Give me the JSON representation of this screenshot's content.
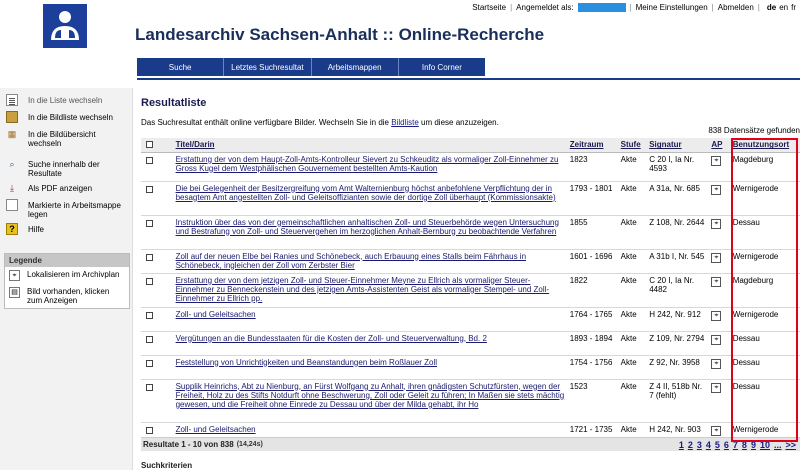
{
  "topbar": {
    "home": "Startseite",
    "logged_in_as": "Angemeldet als:",
    "settings": "Meine Einstellungen",
    "logout": "Abmelden",
    "lang_de": "de",
    "lang_en": "en",
    "lang_fr": "fr"
  },
  "header": {
    "title": "Landesarchiv Sachsen-Anhalt :: Online-Recherche"
  },
  "mainnav": [
    "Suche",
    "Letztes Suchresultat",
    "Arbeitsmappen",
    "Info Corner"
  ],
  "sidebar": {
    "items": [
      {
        "label": "In die Liste wechseln",
        "icon": "list-icon"
      },
      {
        "label": "In die Bildliste wechseln",
        "icon": "image-list-icon"
      },
      {
        "label": "In die Bildübersicht wechseln",
        "icon": "image-grid-icon"
      },
      {
        "label": "Suche innerhalb der Resultate",
        "icon": "search-icon"
      },
      {
        "label": "Als PDF anzeigen",
        "icon": "pdf-icon"
      },
      {
        "label": "Markierte in Arbeitsmappe legen",
        "icon": "folder-icon"
      },
      {
        "label": "Hilfe",
        "icon": "help-icon"
      }
    ],
    "legend": {
      "title": "Legende",
      "items": [
        {
          "label": "Lokalisieren im Archivplan",
          "icon": "locate-icon"
        },
        {
          "label": "Bild vorhanden, klicken zum Anzeigen",
          "icon": "image-icon"
        }
      ]
    }
  },
  "results": {
    "heading": "Resultatliste",
    "intro_before": "Das Suchresultat enthält online verfügbare Bilder. Wechseln Sie in die ",
    "intro_link": "Bildliste",
    "intro_after": " um diese anzuzeigen.",
    "count": "838 Datensätze gefunden",
    "columns": [
      "Titel/Darin",
      "Zeitraum",
      "Stufe",
      "Signatur",
      "AP",
      "Benutzungsort"
    ],
    "rows": [
      {
        "title": "Erstattung der von dem Haupt-Zoll-Amts-Kontrolleur Sievert zu Schkeuditz als vormaliger Zoll-Einnehmer zu Gross Kugel dem Westphälischen Gouvernement bestellten Amts-Kaution",
        "zeitraum": "1823",
        "stufe": "Akte",
        "signatur": "C 20 I, Ia Nr. 4593",
        "ort": "Magdeburg"
      },
      {
        "title": "Die bei Gelegenheit der Besitzergreifung vom Amt Walternienburg höchst anbefohlene Verpflichtung der in besagtem Amt angestellten Zoll- und Geleitsoffizianten sowie der dortige Zoll überhaupt (Kommissionsakte)",
        "zeitraum": "1793 - 1801",
        "stufe": "Akte",
        "signatur": "A 31a, Nr. 685",
        "ort": "Wernigerode"
      },
      {
        "title": "Instruktion über das von der gemeinschaftlichen anhaltischen Zoll- und Steuerbehörde wegen Untersuchung und Bestrafung von Zoll- und Steuervergehen im herzoglichen Anhalt-Bernburg zu beobachtende Verfahren",
        "zeitraum": "1855",
        "stufe": "Akte",
        "signatur": "Z 108, Nr. 2644",
        "ort": "Dessau"
      },
      {
        "title": "Zoll auf der neuen Elbe bei Ranies und Schönebeck, auch Erbauung eines Stalls beim Fährhaus in Schönebeck, ingleichen der Zoll vom Zerbster Bier",
        "zeitraum": "1601 - 1696",
        "stufe": "Akte",
        "signatur": "A 31b I, Nr. 545",
        "ort": "Wernigerode"
      },
      {
        "title": "Erstattung der von dem jetzigen Zoll- und Steuer-Einnehmer Meyne zu Ellrich als vormaliger Steuer-Einnehmer zu Benneckenstein und des jetzigen Amts-Assistenten Geist als vormaliger Stempel- und Zoll-Einnehmer zu Ellrich pp.",
        "zeitraum": "1822",
        "stufe": "Akte",
        "signatur": "C 20 I, Ia Nr. 4482",
        "ort": "Magdeburg"
      },
      {
        "title": "Zoll- und Geleitsachen",
        "zeitraum": "1764 - 1765",
        "stufe": "Akte",
        "signatur": "H 242, Nr. 912",
        "ort": "Wernigerode"
      },
      {
        "title": "Vergütungen an die Bundesstaaten für die Kosten der Zoll- und Steuerverwaltung, Bd. 2",
        "zeitraum": "1893 - 1894",
        "stufe": "Akte",
        "signatur": "Z 109, Nr. 2794",
        "ort": "Dessau"
      },
      {
        "title": "Feststellung von Unrichtigkeiten und Beanstandungen beim Roßlauer Zoll",
        "zeitraum": "1754 - 1756",
        "stufe": "Akte",
        "signatur": "Z 92, Nr. 3958",
        "ort": "Dessau"
      },
      {
        "title": "Supplik Heinrichs, Abt zu Nienburg, an Fürst Wolfgang zu Anhalt, ihren gnädigsten Schutzfürsten, wegen der Freiheit, Holz zu des Stifts Notdurft ohne Beschwerung, Zoll oder Geleit zu führen; In Maßen sie stets mächtig gewesen, und die Freiheit ohne Einrede zu Dessau und über der Milda gehabt, ihr Ho",
        "zeitraum": "1523",
        "stufe": "Akte",
        "signatur": "Z 4 II, 518b Nr. 7 (fehlt)",
        "ort": "Dessau"
      },
      {
        "title": "Zoll- und Geleitsachen",
        "zeitraum": "1721 - 1735",
        "stufe": "Akte",
        "signatur": "H 242, Nr. 903",
        "ort": "Wernigerode"
      }
    ]
  },
  "pager": {
    "summary": "Resultate 1 - 10 von 838",
    "time": "(14,24s)",
    "pages": [
      "1",
      "2",
      "3",
      "4",
      "5",
      "6",
      "7",
      "8",
      "9",
      "10",
      "...",
      ">>"
    ]
  },
  "criteria_label": "Suchkriterien",
  "colors": {
    "nav": "#1a3a8a",
    "highlight": "#e0001a",
    "link": "#1a1a70"
  }
}
